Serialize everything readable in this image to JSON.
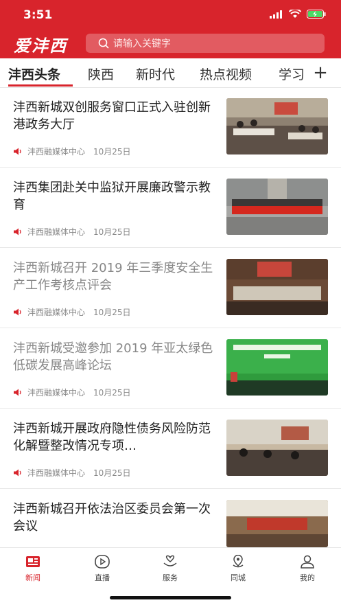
{
  "status": {
    "time": "3:51"
  },
  "header": {
    "logo": "爱沣西",
    "search_placeholder": "请输入关键字"
  },
  "tabs": [
    "沣西头条",
    "陕西",
    "新时代",
    "热点视频",
    "学习"
  ],
  "tabs_more": "+",
  "news": [
    {
      "title": "沣西新城双创服务窗口正式入驻创新港政务大厅",
      "source": "沣西融媒体中心",
      "date": "10月25日",
      "read": false
    },
    {
      "title": "沣西集团赴关中监狱开展廉政警示教育",
      "source": "沣西融媒体中心",
      "date": "10月25日",
      "read": false
    },
    {
      "title": "沣西新城召开 2019 年三季度安全生产工作考核点评会",
      "source": "沣西融媒体中心",
      "date": "10月25日",
      "read": true
    },
    {
      "title": "沣西新城受邀参加 2019 年亚太绿色低碳发展高峰论坛",
      "source": "沣西融媒体中心",
      "date": "10月25日",
      "read": true
    },
    {
      "title": "沣西新城开展政府隐性债务风险防范化解暨整改情况专项…",
      "source": "沣西融媒体中心",
      "date": "10月25日",
      "read": false
    },
    {
      "title": "沣西新城召开依法治区委员会第一次会议",
      "source": "",
      "date": "",
      "read": false
    }
  ],
  "tabbar": [
    {
      "label": "新闻",
      "icon": "news-icon",
      "active": true
    },
    {
      "label": "直播",
      "icon": "play-icon",
      "active": false
    },
    {
      "label": "服务",
      "icon": "heart-hand-icon",
      "active": false
    },
    {
      "label": "同城",
      "icon": "location-icon",
      "active": false
    },
    {
      "label": "我的",
      "icon": "user-icon",
      "active": false
    }
  ],
  "colors": {
    "brand": "#d8242c",
    "text": "#222222",
    "muted": "#888888"
  }
}
